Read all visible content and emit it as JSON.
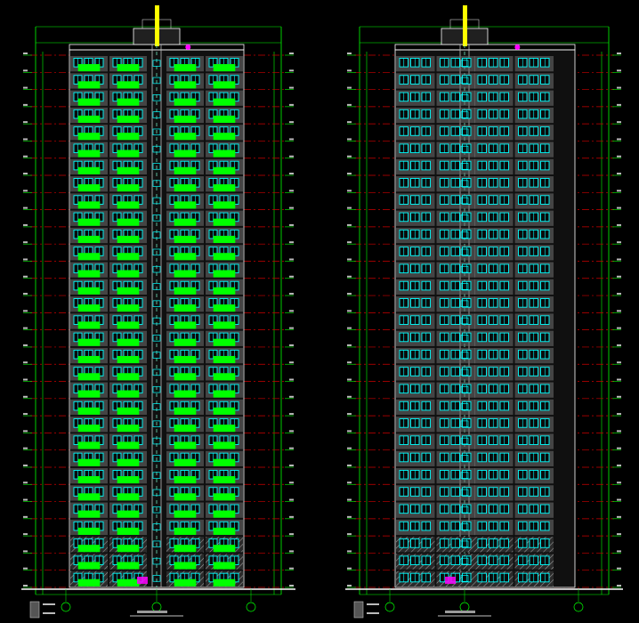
{
  "drawing": {
    "background": "#000000",
    "colors": {
      "dimension": "#00ff00",
      "grid_floor": "#cc0000",
      "window_frame": "#00ffff",
      "balcony": "#00ff00",
      "wall": "#707070",
      "outline": "#ffffff",
      "accent": "#ff00ff",
      "title_marker": "#ffff00"
    },
    "elevations": [
      {
        "id": "left",
        "floors": 31,
        "base_hatched_floors": 3,
        "bays": 4,
        "has_green_balconies": true,
        "legend_entries": [
          "",
          ""
        ],
        "title_text": ""
      },
      {
        "id": "right",
        "floors": 31,
        "base_hatched_floors": 3,
        "bays": 4,
        "has_green_balconies": false,
        "legend_entries": [
          "",
          ""
        ],
        "title_text": ""
      }
    ]
  }
}
